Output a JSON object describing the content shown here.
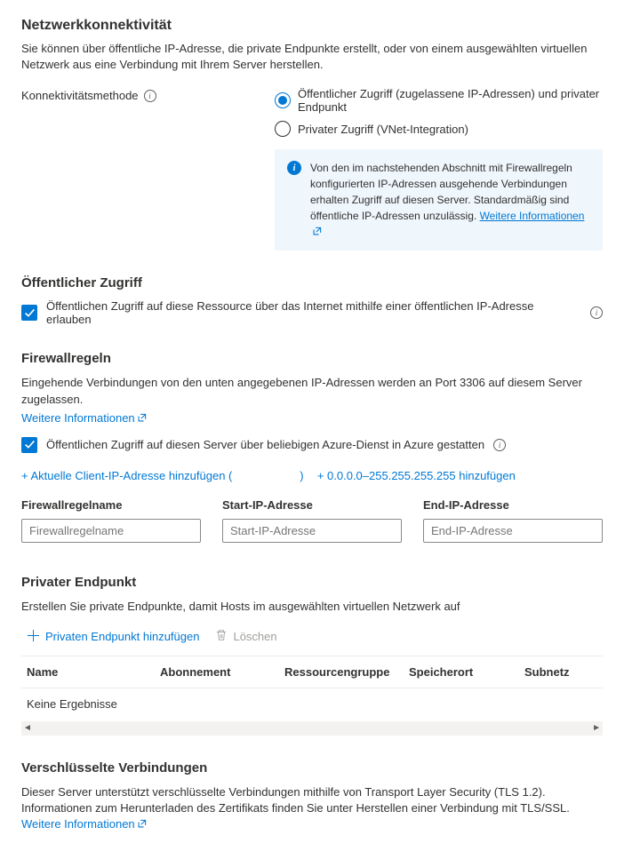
{
  "network": {
    "title": "Netzwerkkonnektivität",
    "description": "Sie können über öffentliche IP-Adresse, die private Endpunkte erstellt, oder von einem ausgewählten virtuellen Netzwerk aus eine Verbindung mit Ihrem Server herstellen.",
    "method_label": "Konnektivitätsmethode",
    "radio_public": "Öffentlicher Zugriff (zugelassene IP-Adressen) und privater Endpunkt",
    "radio_private": "Privater Zugriff (VNet-Integration)",
    "info_box": "Von den im nachstehenden Abschnitt mit Firewallregeln konfigurierten IP-Adressen ausgehende Verbindungen erhalten Zugriff auf diesen Server. Standardmäßig sind öffentliche IP-Adressen unzulässig.",
    "info_link": "Weitere Informationen"
  },
  "public_access": {
    "title": "Öffentlicher Zugriff",
    "checkbox_label": "Öffentlichen Zugriff auf diese Ressource über das Internet mithilfe einer öffentlichen IP-Adresse erlauben"
  },
  "firewall": {
    "title": "Firewallregeln",
    "description": "Eingehende Verbindungen von den unten angegebenen IP-Adressen werden an Port 3306 auf diesem Server zugelassen.",
    "more_info": "Weitere Informationen",
    "azure_checkbox": "Öffentlichen Zugriff auf diesen Server über beliebigen Azure-Dienst in Azure gestatten",
    "add_client_prefix": "+ Aktuelle Client-IP-Adresse hinzufügen (",
    "add_client_suffix": ")",
    "add_all": "+ 0.0.0.0–255.255.255.255 hinzufügen",
    "col_name": "Firewallregelname",
    "col_start": "Start-IP-Adresse",
    "col_end": "End-IP-Adresse",
    "ph_name": "Firewallregelname",
    "ph_start": "Start-IP-Adresse",
    "ph_end": "End-IP-Adresse"
  },
  "endpoint": {
    "title": "Privater Endpunkt",
    "description": "Erstellen Sie private Endpunkte, damit Hosts im ausgewählten virtuellen Netzwerk auf",
    "add_btn": "Privaten Endpunkt hinzufügen",
    "delete_btn": "Löschen",
    "col_name": "Name",
    "col_sub": "Abonnement",
    "col_rg": "Ressourcengruppe",
    "col_loc": "Speicherort",
    "col_subnet": "Subnetz",
    "no_results": "Keine Ergebnisse"
  },
  "encrypted": {
    "title": "Verschlüsselte Verbindungen",
    "description": "Dieser Server unterstützt verschlüsselte Verbindungen mithilfe von Transport Layer Security (TLS 1.2). Informationen zum Herunterladen des Zertifikats finden Sie unter Herstellen einer Verbindung mit TLS/SSL.",
    "link": "Weitere Informationen"
  }
}
